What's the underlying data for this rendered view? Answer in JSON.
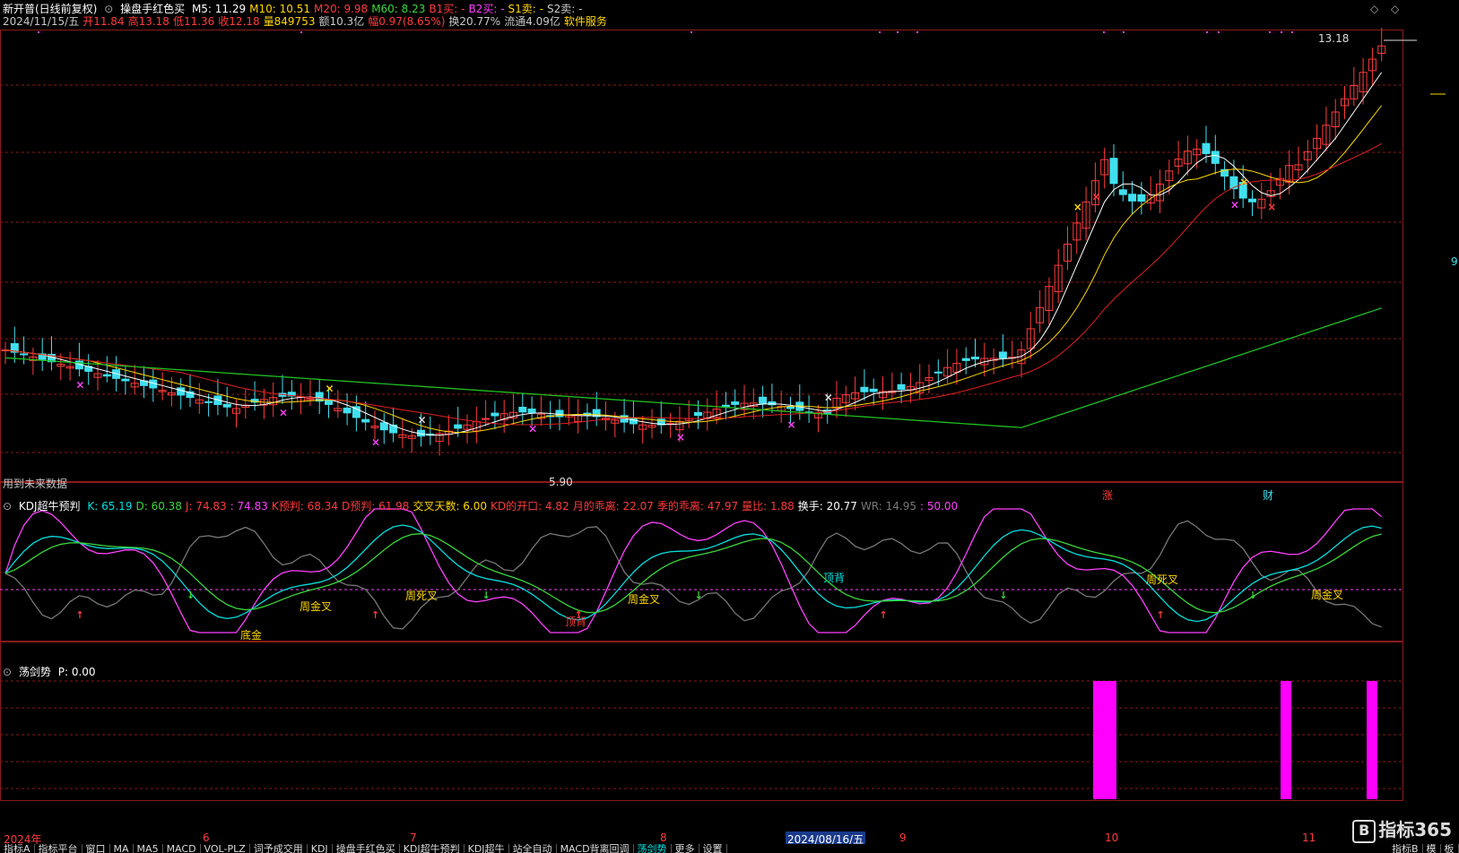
{
  "header": {
    "stock_name": "新开普(日线前复权)",
    "indicator": "操盘手红色买",
    "ma": [
      {
        "label": "M5: 11.29",
        "color": "#ffffff"
      },
      {
        "label": "M10: 10.51",
        "color": "#ffd700"
      },
      {
        "label": "M20: 9.98",
        "color": "#ff3b3b"
      },
      {
        "label": "M60: 8.23",
        "color": "#3bd63b"
      },
      {
        "label": "B1买: -",
        "color": "#ff3b3b"
      },
      {
        "label": "B2买: -",
        "color": "#ff40ff"
      },
      {
        "label": "S1卖: -",
        "color": "#ffd700"
      },
      {
        "label": "S2卖: -",
        "color": "#c8c8c8"
      }
    ],
    "quote": [
      {
        "label": "2024/11/15/五",
        "color": "#c8c8c8"
      },
      {
        "label": "开11.84",
        "color": "#ff3b3b"
      },
      {
        "label": "高13.18",
        "color": "#ff3b3b"
      },
      {
        "label": "低11.36",
        "color": "#ff3b3b"
      },
      {
        "label": "收12.18",
        "color": "#ff3b3b"
      },
      {
        "label": "量849753",
        "color": "#ffd700"
      },
      {
        "label": "额10.3亿",
        "color": "#c8c8c8"
      },
      {
        "label": "幅0.97(8.65%)",
        "color": "#ff3b3b"
      },
      {
        "label": "换20.77%",
        "color": "#c8c8c8"
      },
      {
        "label": "流通4.09亿",
        "color": "#c8c8c8"
      },
      {
        "label": "软件服务",
        "color": "#ffd700"
      }
    ],
    "price_high": "13.18",
    "price_low": "5.90",
    "future_data_note": "用到未来数据",
    "badge_zhang": "涨",
    "badge_cai": "财",
    "right_edge_label": "9"
  },
  "kdj": {
    "title": "KDJ超牛预判",
    "values": [
      {
        "label": "K: 65.19",
        "color": "#00e0e0"
      },
      {
        "label": "D: 60.38",
        "color": "#3bd63b"
      },
      {
        "label": "J: 74.83",
        "color": "#ff3b3b"
      },
      {
        "label": ": 74.83",
        "color": "#ff40ff"
      },
      {
        "label": "K预判: 68.34",
        "color": "#ff3b3b"
      },
      {
        "label": "D预判: 61.98",
        "color": "#ff3b3b"
      },
      {
        "label": "交叉天数: 6.00",
        "color": "#ffd700"
      },
      {
        "label": "KD的开口: 4.82",
        "color": "#ff3b3b"
      },
      {
        "label": "月的乖离: 22.07",
        "color": "#ff3b3b"
      },
      {
        "label": "季的乖离: 47.97",
        "color": "#ff3b3b"
      },
      {
        "label": "量比: 1.88",
        "color": "#ff3b3b"
      },
      {
        "label": "换手: 20.77",
        "color": "#ffffff"
      },
      {
        "label": "WR: 14.95",
        "color": "#777777"
      },
      {
        "label": ": 50.00",
        "color": "#ff40ff"
      }
    ],
    "annotations": [
      {
        "text": "底金",
        "color": "#ffd700"
      },
      {
        "text": "周金叉",
        "color": "#ffd700"
      },
      {
        "text": "周死叉",
        "color": "#ffd700"
      },
      {
        "text": "顶背",
        "color": "#ff3b3b"
      },
      {
        "text": "周金叉",
        "color": "#ffd700"
      },
      {
        "text": "顶背",
        "color": "#00e0e0"
      },
      {
        "text": "周死叉",
        "color": "#ffd700"
      },
      {
        "text": "周金叉",
        "color": "#ffd700"
      }
    ]
  },
  "dangjian": {
    "title": "荡剑势",
    "value": "P: 0.00"
  },
  "axis": {
    "labels": [
      "2024年",
      "6",
      "7",
      "8",
      "2024/08/16/五",
      "9",
      "10",
      "11"
    ]
  },
  "tabs": [
    "指标A",
    "指标平台",
    "窗口",
    "MA",
    "MA5",
    "MACD",
    "VOL-PLZ",
    "词予成交用",
    "KDJ",
    "操盘手红色买",
    "KDJ超牛预判",
    "KDJ超牛",
    "站全自动",
    "MACD背离回调",
    "荡剑势",
    "更多",
    "设置"
  ],
  "tab_active": "荡剑势",
  "right_tabs": [
    "指标B",
    "模",
    "板"
  ],
  "logo": "指标365",
  "colors": {
    "up": "#ff3b3b",
    "down": "#40e0f0",
    "ma5": "#ffffff",
    "ma10": "#ffd700",
    "ma20": "#e02020",
    "ma60": "#20c020",
    "magenta": "#ff00ff",
    "grid": "#8b1a1a"
  }
}
